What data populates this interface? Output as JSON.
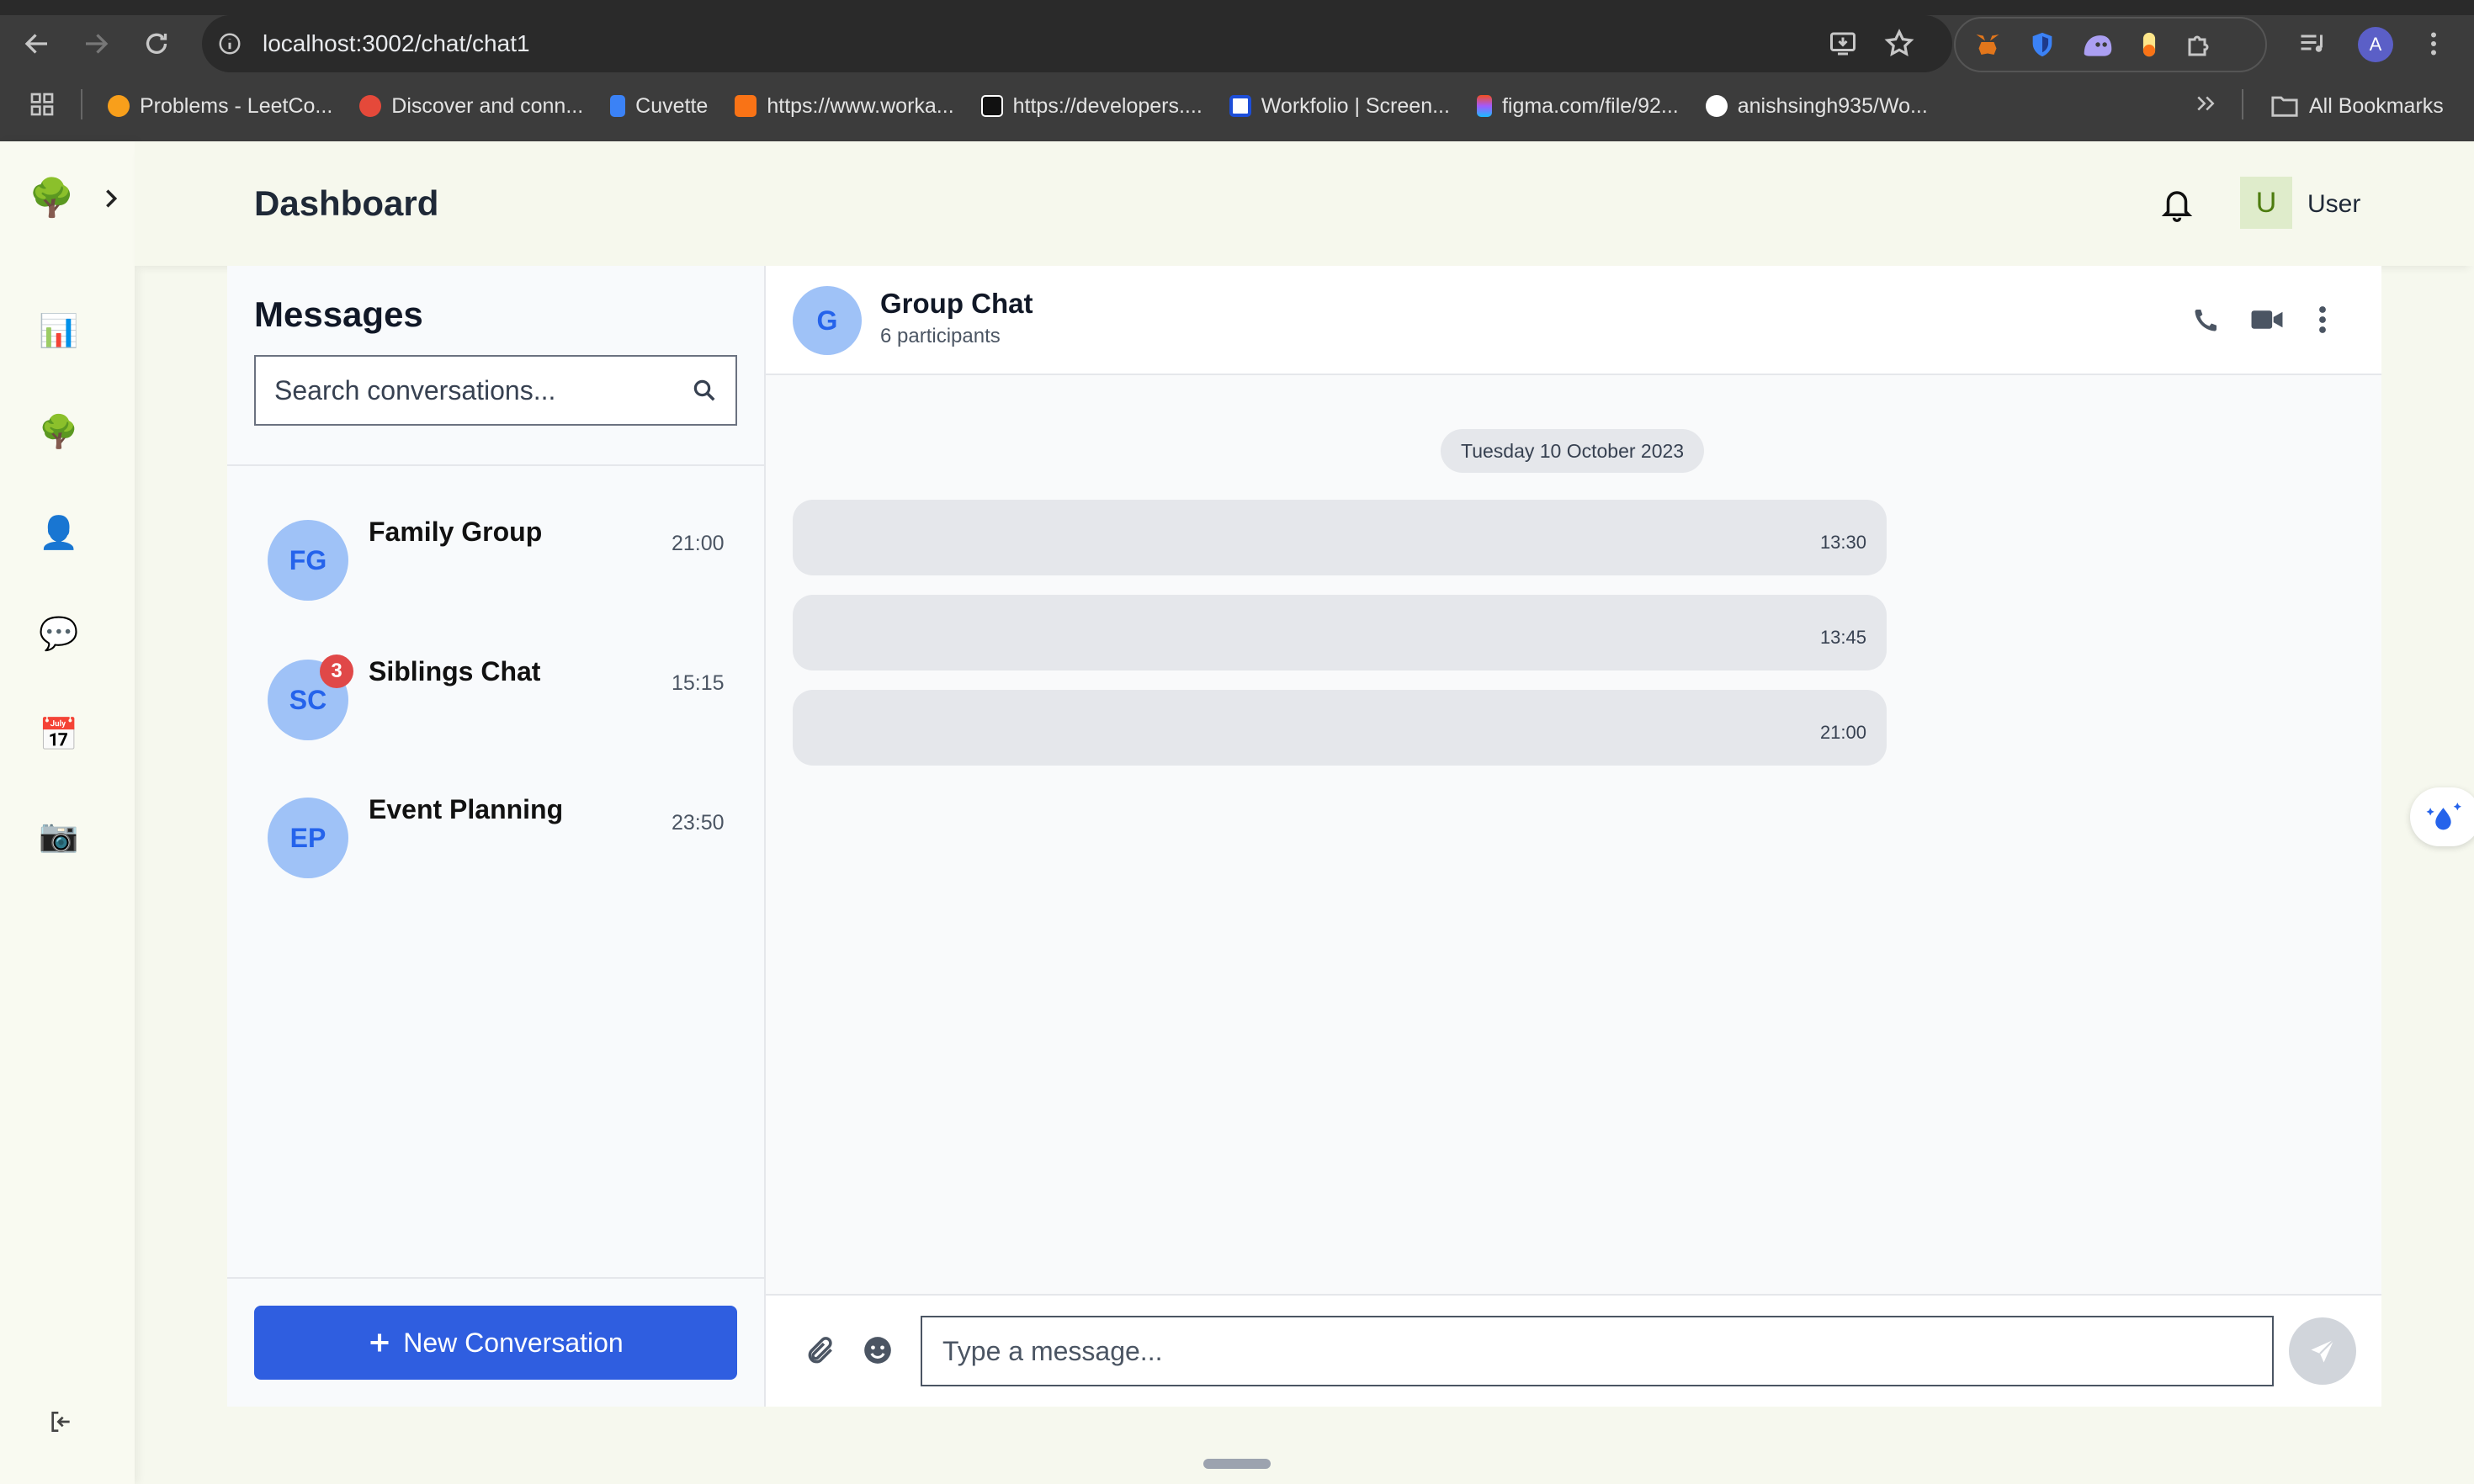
{
  "browser": {
    "url": "localhost:3002/chat/chat1",
    "profile_initial": "A",
    "bookmarks": [
      {
        "label": "Problems - LeetCo...",
        "color": "#f89f1b"
      },
      {
        "label": "Discover and conn...",
        "color": "#e5493a"
      },
      {
        "label": "Cuvette",
        "color": "#3b82f6"
      },
      {
        "label": "https://www.worka...",
        "color": "#f97316"
      },
      {
        "label": "https://developers....",
        "color": "#111111"
      },
      {
        "label": "Workfolio | Screen...",
        "color": "#1d4ed8"
      },
      {
        "label": "figma.com/file/92...",
        "color": "#a259ff"
      },
      {
        "label": "anishsingh935/Wo...",
        "color": "#ffffff"
      }
    ],
    "all_bookmarks": "All Bookmarks"
  },
  "header": {
    "title": "Dashboard",
    "user_initial": "U",
    "user_name": "User"
  },
  "sidebar": {
    "icons": [
      "tree-logo-icon",
      "chart-icon",
      "tree-icon",
      "user-icon",
      "chat-bubble-icon",
      "calendar-icon",
      "camera-icon"
    ]
  },
  "messages": {
    "heading": "Messages",
    "search_placeholder": "Search conversations...",
    "conversations": [
      {
        "initials": "FG",
        "name": "Family Group",
        "time": "21:00",
        "badge": null
      },
      {
        "initials": "SC",
        "name": "Siblings Chat",
        "time": "15:15",
        "badge": "3"
      },
      {
        "initials": "EP",
        "name": "Event Planning",
        "time": "23:50",
        "badge": null
      }
    ],
    "new_conversation_label": "New Conversation"
  },
  "chat": {
    "avatar_initial": "G",
    "title": "Group Chat",
    "subtitle": "6 participants",
    "date_separator": "Tuesday 10 October 2023",
    "messages": [
      {
        "time": "13:30"
      },
      {
        "time": "13:45"
      },
      {
        "time": "21:00"
      }
    ],
    "input_placeholder": "Type a message..."
  },
  "colors": {
    "accent": "#2f5ee0",
    "badge": "#e04848",
    "avatar_bg": "#9fc2f7"
  }
}
